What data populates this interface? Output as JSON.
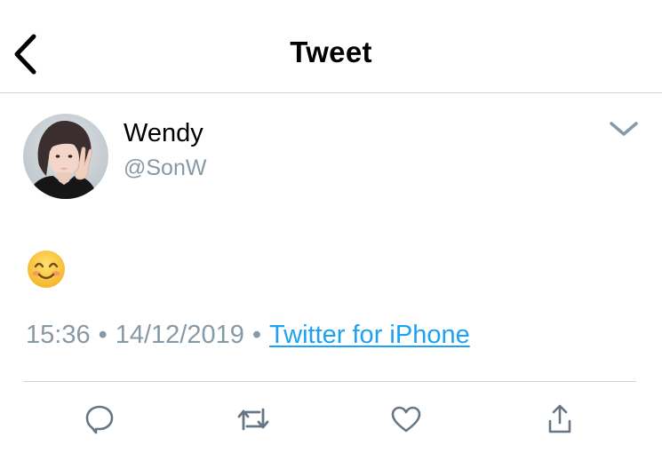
{
  "header": {
    "title": "Tweet",
    "back_icon": "chevron-left-icon"
  },
  "tweet": {
    "author": {
      "display_name": "Wendy",
      "handle": "@SonW"
    },
    "text_emoji": "smiling-face-with-smiling-eyes",
    "time": "15:36",
    "date": "14/12/2019",
    "separator": "•",
    "source": "Twitter for iPhone",
    "menu_icon": "chevron-down-icon"
  },
  "actions": [
    {
      "name": "reply",
      "icon": "reply-icon"
    },
    {
      "name": "retweet",
      "icon": "retweet-icon"
    },
    {
      "name": "like",
      "icon": "heart-icon"
    },
    {
      "name": "share",
      "icon": "share-icon"
    }
  ],
  "colors": {
    "text_primary": "#000000",
    "text_secondary": "#8899a6",
    "link": "#1da1f2",
    "icon": "#657786",
    "divider": "#cfd4d8"
  }
}
